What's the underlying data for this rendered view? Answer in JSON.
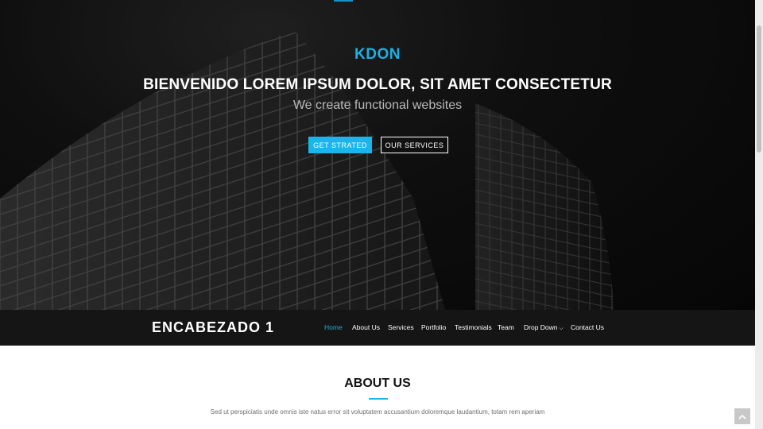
{
  "hero": {
    "brand": "KDON",
    "headline": "BIENVENIDO LOREM IPSUM DOLOR, SIT AMET CONSECTETUR",
    "tagline": "We create functional websites",
    "primary_button": "GET STRATED",
    "secondary_button": "OUR SERVICES"
  },
  "navbar": {
    "logo": "ENCABEZADO 1",
    "items": [
      {
        "label": "Home",
        "active": true
      },
      {
        "label": "About Us"
      },
      {
        "label": "Services"
      },
      {
        "label": "Portfolio"
      },
      {
        "label": "Testimonials"
      },
      {
        "label": "Team"
      },
      {
        "label": "Drop Down",
        "icon": "chevron-down-icon"
      },
      {
        "label": "Contact Us"
      }
    ]
  },
  "about": {
    "title": "ABOUT US",
    "text": "Sed ut perspiciatis unde omnis iste natus error sit voluptatem accusantium doloremque laudantium, totam rem aperiam"
  },
  "scroll_top": {
    "icon": "chevron-up-icon"
  },
  "colors": {
    "accent": "#19b6ea",
    "hero_bg": "#0b0b0b",
    "navbar_bg": "#151515"
  }
}
